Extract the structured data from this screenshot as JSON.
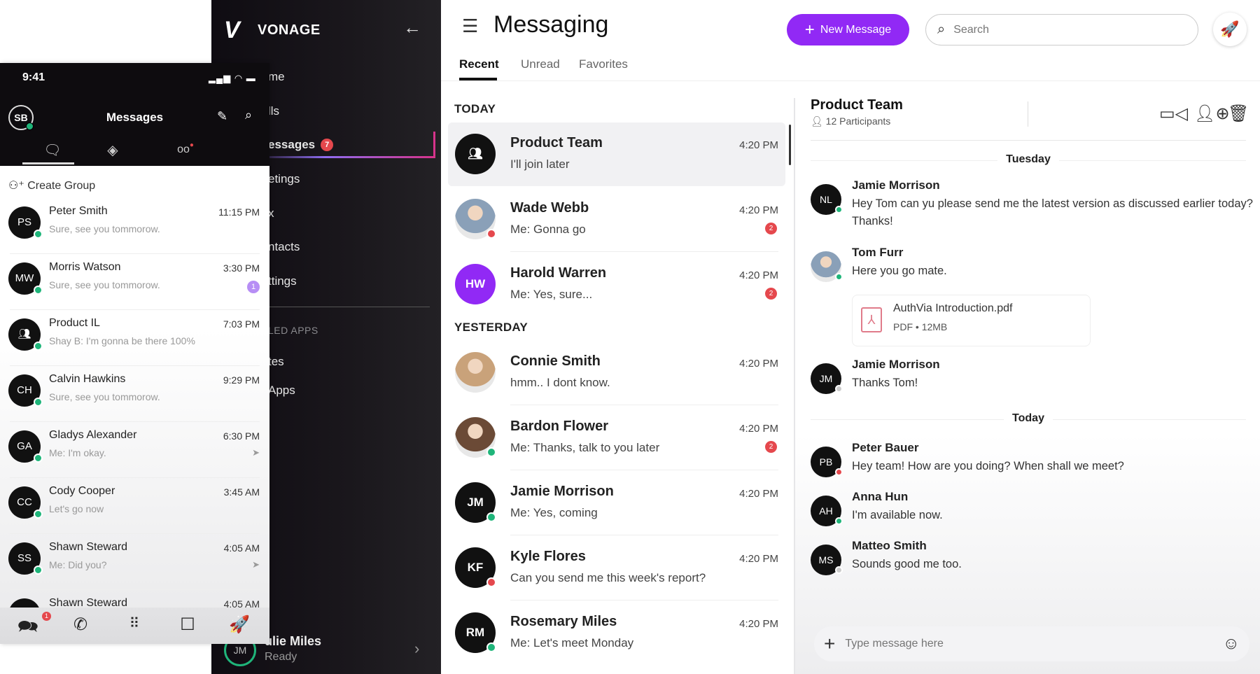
{
  "colors": {
    "accent": "#9129f5",
    "online": "#1fb57a",
    "busy": "#e5484d",
    "sidebar_bg": "#131016"
  },
  "sidebar": {
    "logo": "VONAGE",
    "back_icon": "arrow-left-icon",
    "items": [
      {
        "label": "me"
      },
      {
        "label": "lls"
      },
      {
        "label": "essages",
        "badge": "7",
        "active": true
      },
      {
        "label": "etings"
      },
      {
        "label": "x"
      },
      {
        "label": "ntacts"
      },
      {
        "label": "ttings"
      }
    ],
    "section": "LED APPS",
    "apps": [
      {
        "label": "tes"
      },
      {
        "label": "Apps"
      }
    ],
    "user": {
      "initials": "JM",
      "name": "ulie Miles",
      "status": "Ready"
    }
  },
  "mobile": {
    "time": "9:41",
    "title": "Messages",
    "avatar": "SB",
    "create_group": "Create Group",
    "conversations": [
      {
        "initials": "PS",
        "name": "Peter Smith",
        "preview": "Sure, see you tommorow.",
        "time": "11:15 PM"
      },
      {
        "initials": "MW",
        "name": "Morris Watson",
        "preview": "Sure, see you tommorow.",
        "time": "3:30 PM",
        "badge": "1"
      },
      {
        "initials": "",
        "name": "Product IL",
        "preview": "Shay B: I'm gonna be there 100%",
        "time": "7:03 PM",
        "group": true
      },
      {
        "initials": "CH",
        "name": "Calvin Hawkins",
        "preview": "Sure, see you tommorow.",
        "time": "9:29 PM"
      },
      {
        "initials": "GA",
        "name": "Gladys Alexander",
        "preview": "Me: I'm okay.",
        "time": "6:30 PM",
        "sent": true
      },
      {
        "initials": "CC",
        "name": "Cody Cooper",
        "preview": "Let's go now",
        "time": "3:45 AM"
      },
      {
        "initials": "SS",
        "name": "Shawn Steward",
        "preview": "Me: Did you?",
        "time": "4:05 AM",
        "sent": true
      },
      {
        "initials": "",
        "name": "Shawn Steward",
        "preview": "",
        "time": "4:05 AM"
      }
    ],
    "bottom_badge": "1"
  },
  "main": {
    "title": "Messaging",
    "new_message": "New Message",
    "search_placeholder": "Search",
    "tabs": [
      "Recent",
      "Unread",
      "Favorites"
    ],
    "sections": {
      "today": "TODAY",
      "yesterday": "YESTERDAY"
    },
    "conversations": [
      {
        "initials": "",
        "name": "Product Team",
        "preview": "I'll join later",
        "time": "4:20 PM",
        "group": true,
        "selected": true
      },
      {
        "initials": "",
        "name": "Wade Webb",
        "preview": "Me: Gonna go",
        "time": "4:20 PM",
        "badge": "2",
        "photo": "#8aa0b8",
        "status": "#e5484d"
      },
      {
        "initials": "HW",
        "name": "Harold Warren",
        "preview": "Me: Yes, sure...",
        "time": "4:20 PM",
        "badge": "2",
        "color": "#9129f5"
      },
      {
        "initials": "",
        "name": "Connie Smith",
        "preview": "hmm.. I dont know.",
        "time": "4:20 PM",
        "photo": "#c9a27a"
      },
      {
        "initials": "",
        "name": "Bardon Flower",
        "preview": "Me: Thanks, talk to you later",
        "time": "4:20 PM",
        "badge": "2",
        "photo": "#6b4a36",
        "status": "#1fb57a"
      },
      {
        "initials": "JM",
        "name": "Jamie Morrison",
        "preview": "Me: Yes, coming",
        "time": "4:20 PM",
        "status": "#1fb57a"
      },
      {
        "initials": "KF",
        "name": "Kyle Flores",
        "preview": "Can you send me this week's report?",
        "time": "4:20 PM",
        "status": "#e5484d"
      },
      {
        "initials": "RM",
        "name": "Rosemary Miles",
        "preview": "Me: Let's meet Monday",
        "time": "4:20 PM",
        "status": "#1fb57a"
      }
    ]
  },
  "chat": {
    "title": "Product Team",
    "participants": "12 Participants",
    "days": [
      "Tuesday",
      "Today"
    ],
    "messages": [
      {
        "initials": "NL",
        "name": "Jamie Morrison",
        "text": "Hey Tom can yu please send me the latest version as discussed earlier today? Thanks!",
        "status": "#1fb57a"
      },
      {
        "initials": "",
        "name": "Tom Furr",
        "text": "Here you go mate.",
        "status": "#1fb57a",
        "photo": "#8aa0b8"
      },
      {
        "initials": "JM",
        "name": "Jamie Morrison",
        "text": "Thanks Tom!",
        "status": "#cccccc"
      },
      {
        "initials": "PB",
        "name": "Peter Bauer",
        "text": "Hey team! How are you doing? When shall we meet?",
        "status": "#e5484d"
      },
      {
        "initials": "AH",
        "name": "Anna Hun",
        "text": "I'm available now.",
        "status": "#1fb57a"
      },
      {
        "initials": "MS",
        "name": "Matteo Smith",
        "text": "Sounds good me too.",
        "status": "#cccccc"
      }
    ],
    "attachment": {
      "name": "AuthVia Introduction.pdf",
      "type": "PDF",
      "size": "12MB"
    },
    "composer_placeholder": "Type message here"
  }
}
